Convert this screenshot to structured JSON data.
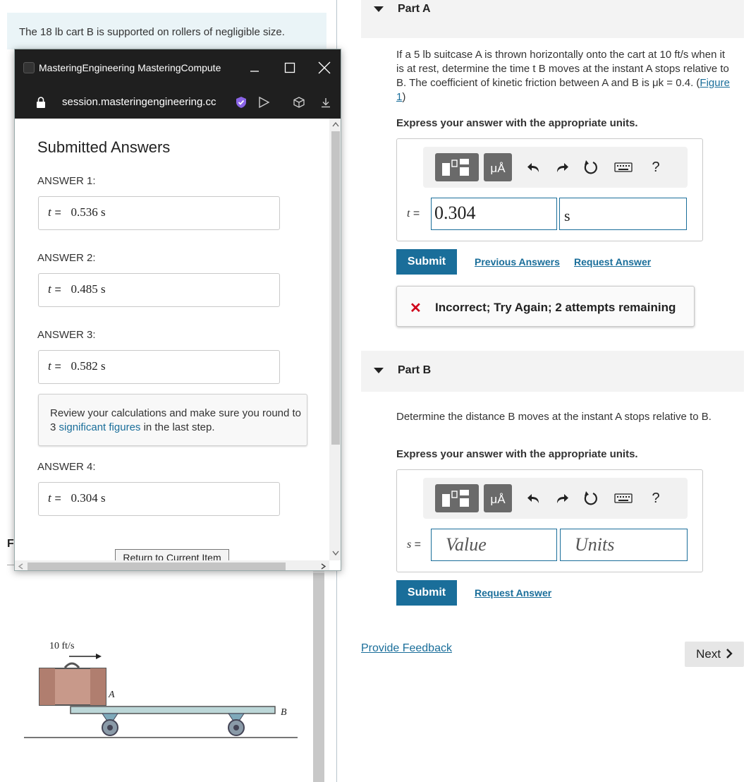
{
  "problem": {
    "intro_text": "The 18 lb cart B is supported on rollers of negligible size.",
    "left_letter": "F"
  },
  "popup": {
    "window_title": "MasteringEngineering MasteringCompute",
    "url": "session.masteringengineering.cc",
    "heading": "Submitted Answers",
    "answers": [
      {
        "label": "ANSWER 1:",
        "var": "t",
        "value": "0.536 s"
      },
      {
        "label": "ANSWER 2:",
        "var": "t",
        "value": "0.485 s"
      },
      {
        "label": "ANSWER 3:",
        "var": "t",
        "value": "0.582 s"
      },
      {
        "label": "ANSWER 4:",
        "var": "t",
        "value": "0.304 s"
      }
    ],
    "feedback_text_1": "Review your calculations and make sure you round to 3 ",
    "feedback_link": "significant figures",
    "feedback_text_2": " in the last step.",
    "return_button": "Return to Current Item"
  },
  "figure": {
    "velocity_label": "10 ft/s",
    "label_a": "A",
    "label_b": "B"
  },
  "part_a": {
    "title": "Part A",
    "prompt": "If a 5 lb suitcase A is thrown horizontally onto the cart at 10 ft/s when it is at rest, determine the time t B moves at the instant A stops relative to B. The coefficient of kinetic friction between A and B is μk = 0.4.",
    "figure_link": "Figure 1",
    "units_prompt": "Express your answer with the appropriate units.",
    "var_label": "t =",
    "value": "0.304",
    "units": "s",
    "submit": "Submit",
    "previous_answers": "Previous Answers",
    "request_answer": "Request Answer",
    "result_text": "Incorrect; Try Again; 2 attempts remaining"
  },
  "part_b": {
    "title": "Part B",
    "prompt": "Determine the distance B moves at the instant A stops relative to B.",
    "units_prompt": "Express your answer with the appropriate units.",
    "var_label": "s =",
    "value_placeholder": "Value",
    "units_placeholder": "Units",
    "submit": "Submit",
    "request_answer": "Request Answer"
  },
  "toolbar": {
    "units_button": "μÅ",
    "help": "?"
  },
  "footer": {
    "provide_feedback": "Provide Feedback",
    "next": "Next"
  },
  "colors": {
    "accent": "#1a6e9a",
    "error": "#d0021b",
    "intro_bg": "#eaf4f7"
  }
}
